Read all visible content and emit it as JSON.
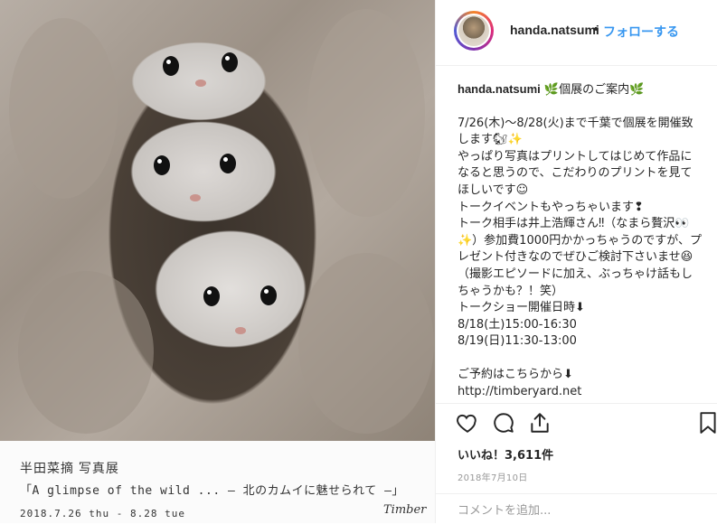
{
  "photo": {
    "caption_title": "半田菜摘 写真展",
    "caption_subtitle": "「A glimpse of the wild ... – 北のカムイに魅せられて –」",
    "caption_dates": "2018.7.26 thu - 8.28 tue",
    "caption_logo": "Timber"
  },
  "header": {
    "username": "handa.natsumi",
    "separator": "•",
    "follow_label": "フォローする"
  },
  "post": {
    "username": "handa.natsumi",
    "lines": [
      " 🌿個展のご案内🌿",
      "",
      "7/26(木)〜8/28(火)まで千葉で個展を開催致します🐿✨",
      "やっぱり写真はプリントしてはじめて作品になると思うので、こだわりのプリントを見てほしいです☺",
      "トークイベントもやっちゃいます❢",
      "トーク相手は井上浩輝さん‼（なまら贅沢👀✨）参加費1000円かかっちゃうのですが、プレゼント付きなのでぜひご検討下さいませ😆",
      "（撮影エピソードに加え、ぶっちゃけ話もしちゃうかも？！笑）",
      "トークショー開催日時⬇",
      "8/18(土)15:00-16:30",
      "8/19(日)11:30-13:00",
      "",
      "ご予約はこちらから⬇",
      "http://timberyard.net"
    ]
  },
  "actions": {
    "like_icon": "heart-icon",
    "comment_icon": "comment-icon",
    "share_icon": "share-icon",
    "save_icon": "bookmark-icon"
  },
  "likes_text": "いいね！3,611件",
  "date_text": "2018年7月10日",
  "comment": {
    "placeholder": "コメントを追加..."
  },
  "colors": {
    "follow": "#3897f0",
    "text": "#262626",
    "muted": "#999999"
  }
}
